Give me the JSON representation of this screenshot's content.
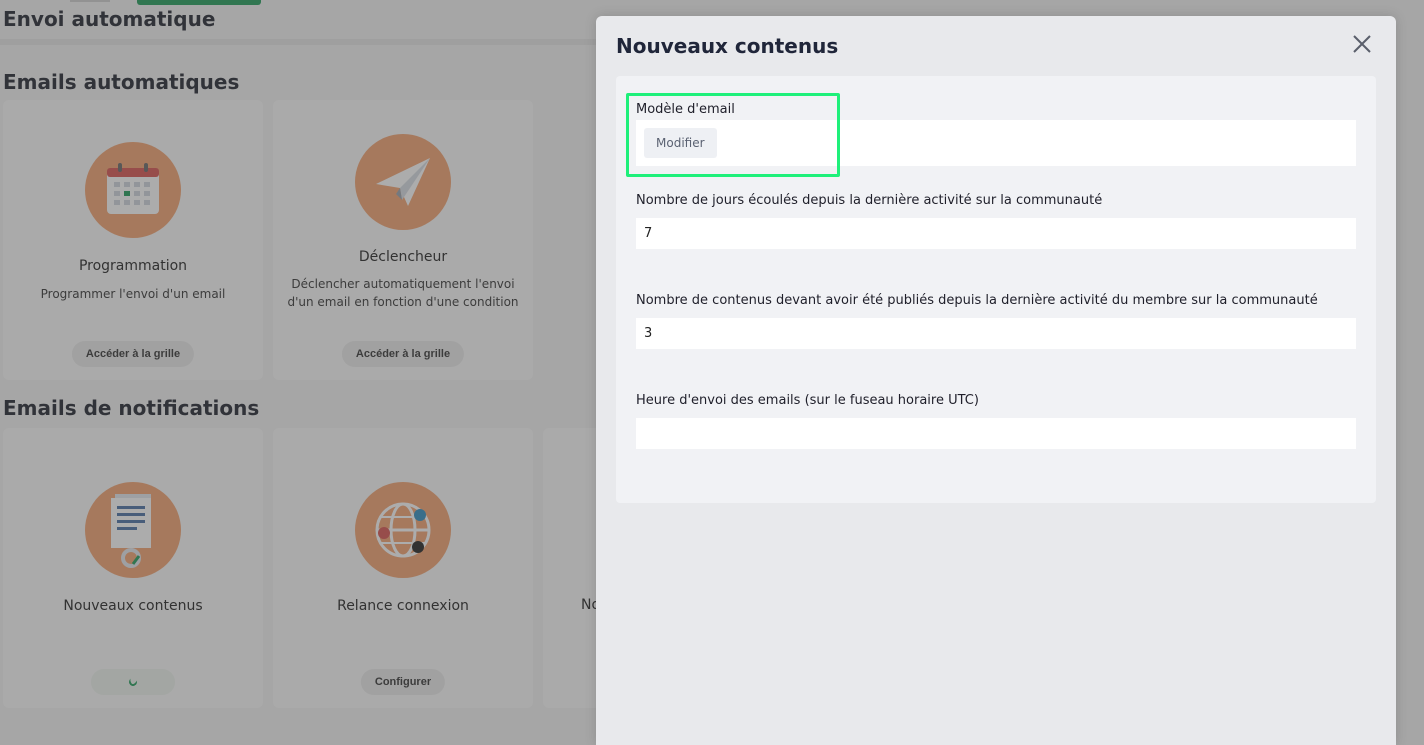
{
  "page": {
    "title": "Envoi automatique"
  },
  "sections": [
    {
      "title": "Emails automatiques",
      "cards": [
        {
          "icon": "calendar-icon",
          "title": "Programmation",
          "desc": "Programmer l'envoi d'un email",
          "button": "Accéder à la grille"
        },
        {
          "icon": "paper-plane-icon",
          "title": "Déclencheur",
          "desc": "Déclencher automatiquement l'envoi d'un email en fonction d'une condition",
          "button": "Accéder à la grille"
        }
      ]
    },
    {
      "title": "Emails de notifications",
      "cards": [
        {
          "icon": "document-icon",
          "title": "Nouveaux contenus",
          "button": ""
        },
        {
          "icon": "globe-network-icon",
          "title": "Relance connexion",
          "button": "Configurer"
        },
        {
          "title_fragment": "No"
        }
      ]
    }
  ],
  "modal": {
    "title": "Nouveaux contenus",
    "template": {
      "label": "Modèle d'email",
      "button": "Modifier"
    },
    "fields": [
      {
        "label": "Nombre de jours écoulés depuis la dernière activité sur la communauté",
        "value": "7"
      },
      {
        "label": "Nombre de contenus devant avoir été publiés depuis la dernière activité du membre sur la communauté",
        "value": "3"
      },
      {
        "label": "Heure d'envoi des emails (sur le fuseau horaire UTC)",
        "value": ""
      }
    ]
  },
  "colors": {
    "icon_circle": "#f4a370",
    "highlight": "#1ef07a",
    "brand_green": "#1f9d5a"
  }
}
